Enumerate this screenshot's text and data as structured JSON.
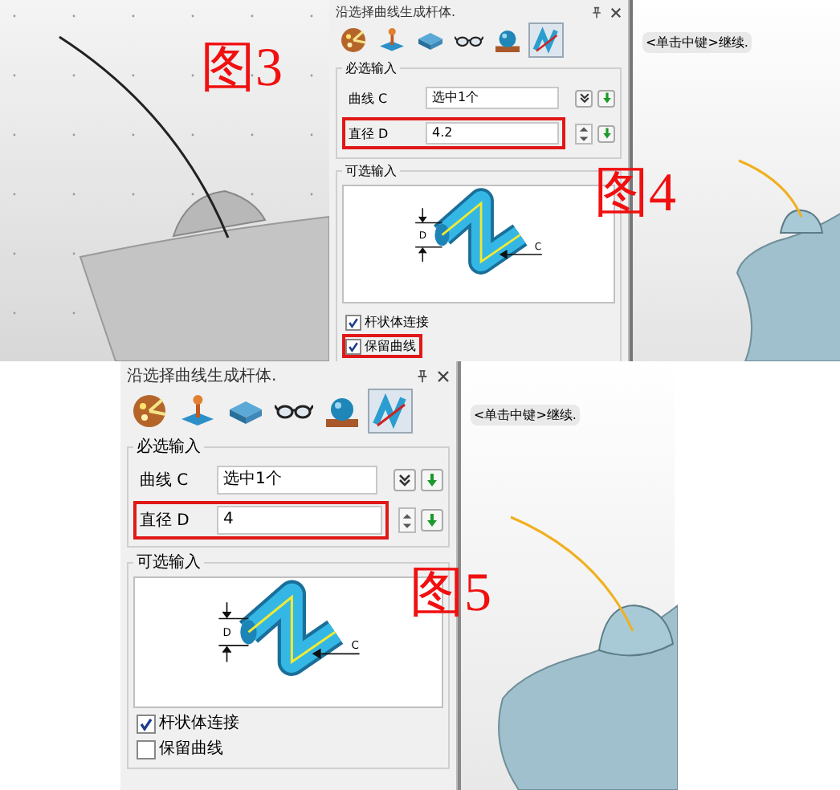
{
  "rows": [
    {
      "cells": [
        {
          "kind": "viewport",
          "caption": "图3",
          "color": "#222222"
        },
        {
          "kind": "panel",
          "title": "沿选择曲线生成杆体.",
          "tools": [
            {
              "kind": "palette",
              "selected": false
            },
            {
              "kind": "joystick",
              "selected": false
            },
            {
              "kind": "slab",
              "selected": false
            },
            {
              "kind": "glasses",
              "selected": false
            },
            {
              "kind": "sphere",
              "selected": false
            },
            {
              "kind": "tube",
              "selected": true
            }
          ],
          "required_label": "必选输入",
          "fields": [
            {
              "label": "曲线 C",
              "value": "选中1个",
              "kind": "picker",
              "highlighted": false
            },
            {
              "label": "直径 D",
              "value": "4.2",
              "kind": "spinner",
              "highlighted": true
            }
          ],
          "optional_label": "可选输入",
          "dimension_labels": [
            "D",
            "C"
          ],
          "options": [
            {
              "label": "杆状体连接",
              "checked": true,
              "highlighted": false
            },
            {
              "label": "保留曲线",
              "checked": true,
              "highlighted": true
            }
          ]
        },
        {
          "kind": "viewport",
          "hint": "<单击中键>继续.",
          "caption": "图4",
          "color": "#f0b020"
        }
      ]
    },
    {
      "cells": [
        {
          "kind": "panel",
          "title": "沿选择曲线生成杆体.",
          "tools": [
            {
              "kind": "palette",
              "selected": false
            },
            {
              "kind": "joystick",
              "selected": false
            },
            {
              "kind": "slab",
              "selected": false
            },
            {
              "kind": "glasses",
              "selected": false
            },
            {
              "kind": "sphere",
              "selected": false
            },
            {
              "kind": "tube",
              "selected": true
            }
          ],
          "required_label": "必选输入",
          "fields": [
            {
              "label": "曲线 C",
              "value": "选中1个",
              "kind": "picker",
              "highlighted": false
            },
            {
              "label": "直径 D",
              "value": "4",
              "kind": "spinner",
              "highlighted": true
            }
          ],
          "optional_label": "可选输入",
          "dimension_labels": [
            "D",
            "C"
          ],
          "options": [
            {
              "label": "杆状体连接",
              "checked": true,
              "highlighted": false
            },
            {
              "label": "保留曲线",
              "checked": false,
              "highlighted": false
            }
          ]
        },
        {
          "kind": "viewport",
          "hint": "<单击中键>继续.",
          "caption": "图5",
          "color": "#f0b020"
        }
      ]
    }
  ]
}
